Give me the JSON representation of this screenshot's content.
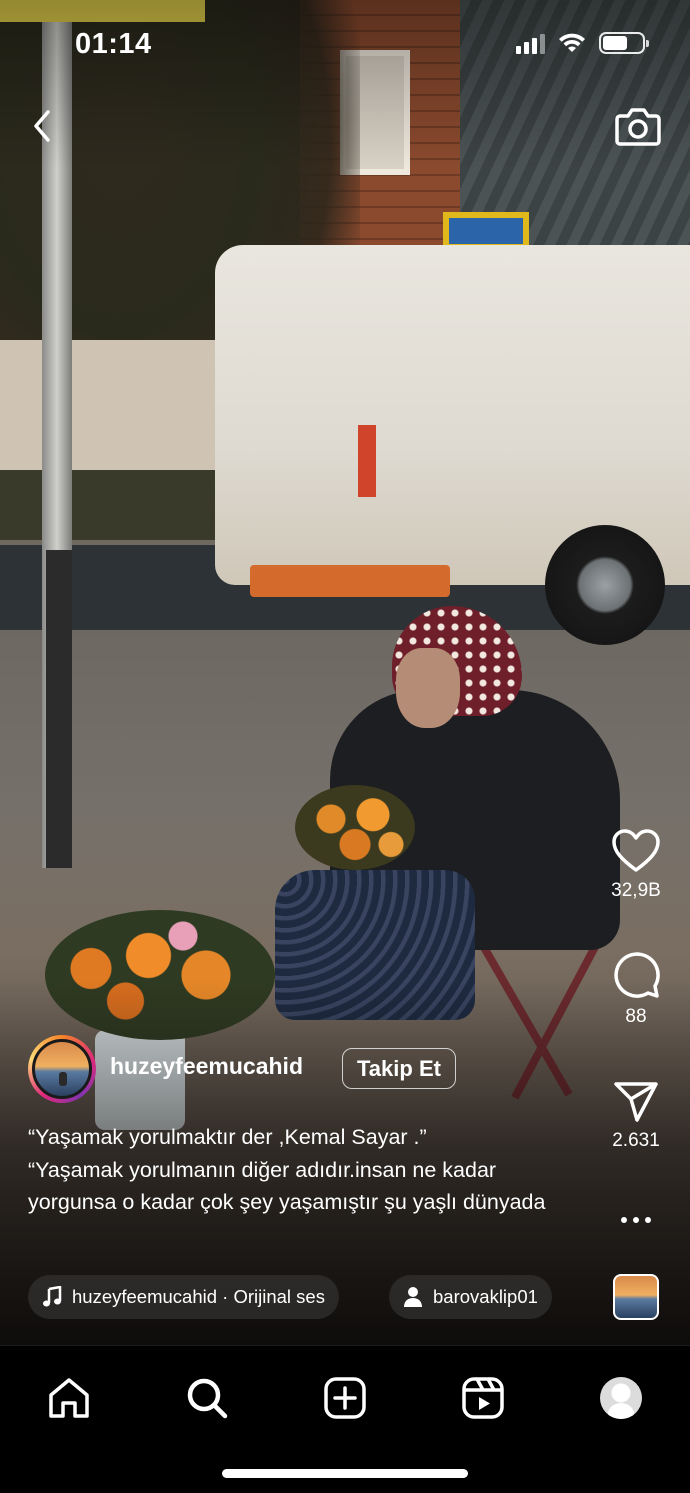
{
  "status_bar": {
    "time": "01:14"
  },
  "header": {
    "back_icon": "chevron-left-icon",
    "camera_icon": "camera-icon"
  },
  "actions": {
    "likes": "32,9B",
    "comments": "88",
    "shares": "2.631"
  },
  "author": {
    "username": "huzeyfeemucahid",
    "follow_label": "Takip Et"
  },
  "caption": {
    "lines": [
      "“Yaşamak yorulmaktır der ,Kemal Sayar .”",
      "“Yaşamak yorulmanın diğer adıdır.insan ne kadar yorgunsa o kadar çok şey yaşamıştır şu yaşlı dünyada"
    ]
  },
  "audio": {
    "label": "huzeyfeemucahid · Orijinal ses",
    "tagged_user": "barovaklip01"
  },
  "nav": {
    "items": [
      "home-icon",
      "search-icon",
      "create-icon",
      "reels-icon",
      "profile-avatar"
    ]
  },
  "colors": {
    "background": "#000000",
    "text": "#ffffff"
  }
}
